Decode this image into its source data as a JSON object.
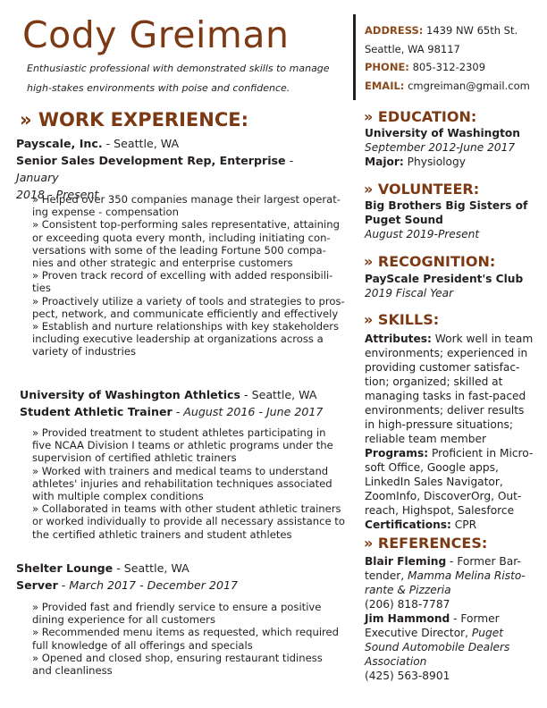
{
  "header": {
    "name": "Cody Greiman",
    "tagline_line1": "Enthusiastic professional with demonstrated skills to manage",
    "tagline_line2": "high-stakes environments with poise and confidence."
  },
  "contact": {
    "address_label": "ADDRESS:",
    "address_line1": "1439 NW 65th St.",
    "address_line2": "Seattle, WA 98117",
    "phone_label": "PHONE:",
    "phone": "805-312-2309",
    "email_label": "EMAIL:",
    "email": "cmgreiman@gmail.com"
  },
  "work": {
    "heading": "WORK EXPERIENCE:",
    "jobs": [
      {
        "org": "Payscale, Inc.",
        "location": " - Seattle, WA",
        "title": "Senior Sales Development Rep, Enterprise",
        "dates_line1": " - January",
        "dates_line2": "2018 - Present",
        "bullets": [
          [
            "» Helped over 350 companies manage their largest operat-",
            "ing expense - compensation"
          ],
          [
            "» Consistent top-performing sales representative, attaining",
            "or exceeding quota every month, including initiating con-",
            "versations with some of the leading Fortune 500 compa-",
            "nies and other strategic and enterprise customers"
          ],
          [
            "» Proven track record of excelling with added responsibili-",
            "ties"
          ],
          [
            "» Proactively utilize a variety of tools and strategies to pros-",
            "pect, network, and communicate efficiently and effectively"
          ],
          [
            "» Establish and nurture relationships with key stakeholders",
            "including executive leadership at organizations across a",
            "variety of industries"
          ]
        ]
      },
      {
        "org": "University of Washington Athletics",
        "location": " - Seattle, WA",
        "title": "Student Athletic Trainer",
        "dates": " - August 2016 - June 2017",
        "bullets": [
          [
            "» Provided treatment to student athletes participating in",
            "five NCAA Division I teams or athletic programs under the",
            "supervision of certified athletic trainers"
          ],
          [
            "» Worked with trainers and medical teams to understand",
            "athletes' injuries and rehabilitation techniques associated",
            "with multiple complex conditions"
          ],
          [
            "» Collaborated in teams with other student athletic trainers",
            "or worked individually to provide all necessary assistance to",
            "the certified athletic trainers and student athletes"
          ]
        ]
      },
      {
        "org": "Shelter Lounge",
        "location": " - Seattle, WA",
        "title": "Server",
        "dates": " - March 2017 - December 2017",
        "bullets": [
          [
            "» Provided fast and friendly service to ensure a positive",
            "dining experience for all customers"
          ],
          [
            "» Recommended menu items as requested, which required",
            "full knowledge of all offerings and specials"
          ],
          [
            "» Opened and closed shop, ensuring restaurant tidiness",
            "and cleanliness"
          ]
        ]
      }
    ]
  },
  "education": {
    "heading": "EDUCATION:",
    "school": "University of Washington",
    "dates": "September 2012-June 2017",
    "major_label": "Major:",
    "major": " Physiology"
  },
  "volunteer": {
    "heading": "VOLUNTEER:",
    "org_line1": "Big Brothers Big Sisters of",
    "org_line2": "Puget Sound",
    "dates": "August 2019-Present"
  },
  "recognition": {
    "heading": "RECOGNITION:",
    "award": "PayScale President's Club",
    "year": "2019 Fiscal Year"
  },
  "skills": {
    "heading": "SKILLS:",
    "attributes_label": "Attributes:",
    "attributes_lines": [
      " Work well in team",
      "environments; experienced in",
      "providing customer satisfac-",
      "tion; organized; skilled at",
      "managing tasks in fast-paced",
      "environments; deliver results",
      "in high-pressure situations;",
      "reliable team member"
    ],
    "programs_label": "Programs:",
    "programs_lines": [
      " Proficient in Micro-",
      "soft Office, Google apps,",
      "LinkedIn Sales Navigator,",
      "ZoomInfo, DiscoverOrg, Out-",
      "reach, Highspot, Salesforce"
    ],
    "certifications_label": "Certifications:",
    "certifications": " CPR"
  },
  "references": {
    "heading": "REFERENCES:",
    "ref1_name": "Blair Fleming",
    "ref1_role_a": " - Former Bar-",
    "ref1_role_b": "tender, ",
    "ref1_place_a": "Mamma Melina Risto-",
    "ref1_place_b": "rante & Pizzeria",
    "ref1_phone": "(206) 818-7787",
    "ref2_name": "Jim Hammond",
    "ref2_role_a": " - Former",
    "ref2_role_b": "Executive Director, ",
    "ref2_place_a": "Puget",
    "ref2_place_b": "Sound Automobile Dealers",
    "ref2_place_c": "Association",
    "ref2_phone": "(425) 563-8901"
  },
  "marker": "»"
}
